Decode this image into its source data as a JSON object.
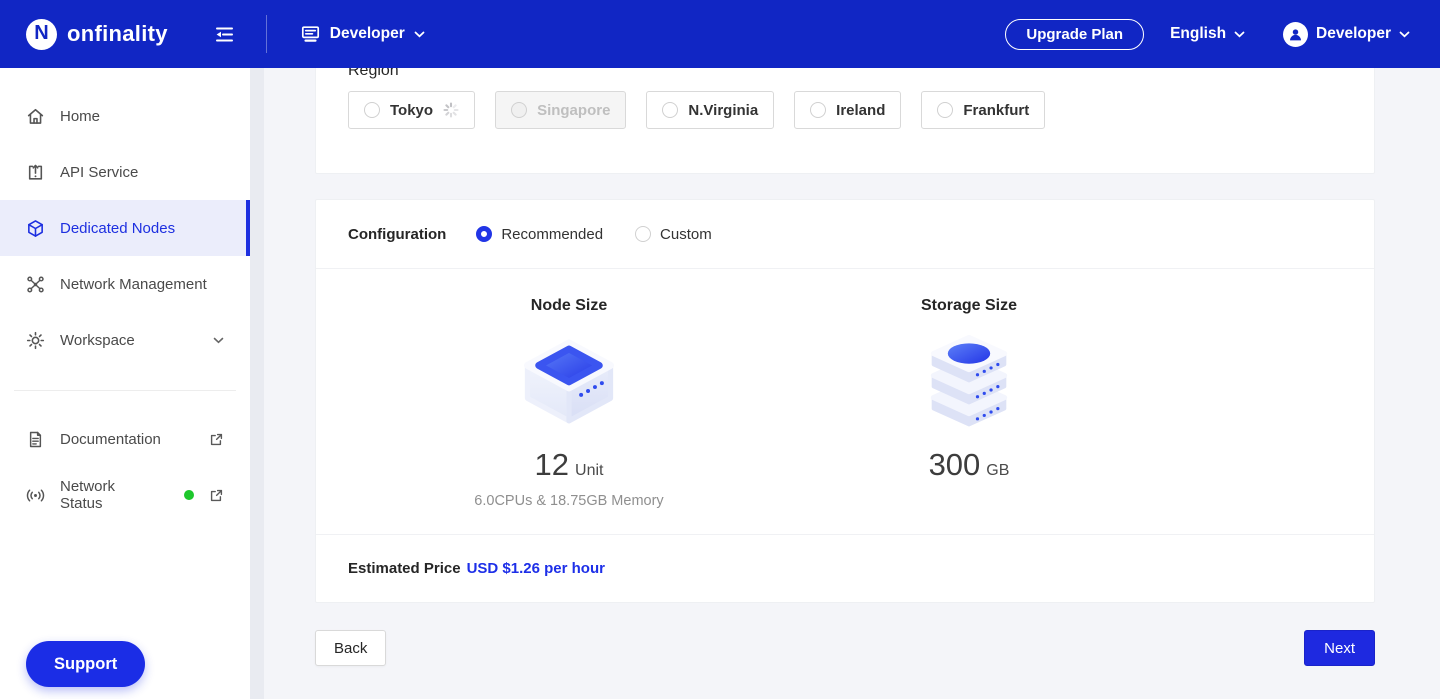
{
  "navbar": {
    "brand": "onfinality",
    "logo_letter": "N",
    "workspace": {
      "label": "Developer"
    },
    "upgrade_button": "Upgrade Plan",
    "language": {
      "label": "English"
    },
    "user": {
      "label": "Developer"
    }
  },
  "sidebar": {
    "items": [
      {
        "label": "Home",
        "icon": "home-icon"
      },
      {
        "label": "API Service",
        "icon": "api-service-icon"
      },
      {
        "label": "Dedicated Nodes",
        "icon": "cube-icon",
        "active": true
      },
      {
        "label": "Network Management",
        "icon": "network-icon"
      },
      {
        "label": "Workspace",
        "icon": "gear-icon",
        "expandable": true
      }
    ],
    "secondary": [
      {
        "label": "Documentation",
        "icon": "document-icon",
        "external": true
      },
      {
        "label": "Network Status",
        "icon": "broadcast-icon",
        "external": true,
        "status": "online"
      }
    ],
    "support_button": "Support"
  },
  "region": {
    "label": "Region",
    "options": [
      {
        "label": "Tokyo",
        "loading": true
      },
      {
        "label": "Singapore",
        "disabled": true
      },
      {
        "label": "N.Virginia"
      },
      {
        "label": "Ireland"
      },
      {
        "label": "Frankfurt"
      }
    ]
  },
  "configuration": {
    "label": "Configuration",
    "options": [
      {
        "label": "Recommended",
        "selected": true
      },
      {
        "label": "Custom",
        "selected": false
      }
    ]
  },
  "node_size": {
    "title": "Node Size",
    "value": "12",
    "unit": "Unit",
    "detail": "6.0CPUs & 18.75GB Memory"
  },
  "storage_size": {
    "title": "Storage Size",
    "value": "300",
    "unit": "GB"
  },
  "price": {
    "label": "Estimated Price",
    "value": "USD $1.26 per hour"
  },
  "actions": {
    "back": "Back",
    "next": "Next"
  },
  "colors": {
    "navbar_blue": "#1126c4",
    "accent_blue": "#1e29e0",
    "link_blue": "#1d2fe8",
    "active_item_bg": "#ebedfb",
    "status_green": "#1ec72c",
    "disabled_bg": "#f5f5f5",
    "page_bg": "#f4f5f9"
  }
}
